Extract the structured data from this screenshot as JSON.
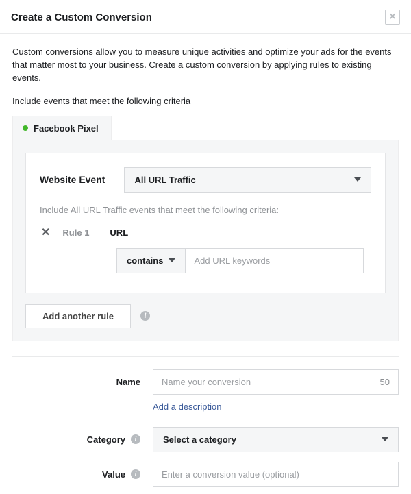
{
  "dialog": {
    "title": "Create a Custom Conversion",
    "intro": "Custom conversions allow you to measure unique activities and optimize your ads for the events that matter most to your business. Create a custom conversion by applying rules to existing events.",
    "criteria_heading": "Include events that meet the following criteria"
  },
  "tab": {
    "label": "Facebook Pixel"
  },
  "event_select": {
    "label": "Website Event",
    "value": "All URL Traffic"
  },
  "rules": {
    "subtext": "Include All URL Traffic events that meet the following criteria:",
    "rule1_name": "Rule 1",
    "url_label": "URL",
    "contains_label": "contains",
    "keyword_placeholder": "Add URL keywords",
    "add_rule_label": "Add another rule"
  },
  "name_field": {
    "label": "Name",
    "placeholder": "Name your conversion",
    "count": "50",
    "add_desc": "Add a description"
  },
  "category_field": {
    "label": "Category",
    "value": "Select a category"
  },
  "value_field": {
    "label": "Value",
    "placeholder": "Enter a conversion value (optional)"
  }
}
